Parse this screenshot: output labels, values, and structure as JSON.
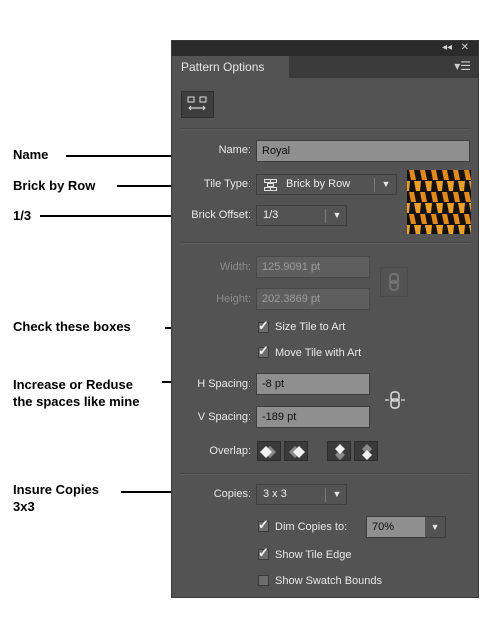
{
  "annotations": {
    "name": "Name",
    "brick_by_row": "Brick by Row",
    "brick_offset": "1/3",
    "check_boxes": "Check these boxes",
    "spacing_line1": "Increase or Reduse",
    "spacing_line2": "the spaces like mine",
    "copies_line1": "Insure Copies",
    "copies_line2": "3x3"
  },
  "panel": {
    "tab_title": "Pattern Options",
    "name_label": "Name:",
    "name_value": "Royal",
    "tile_type_label": "Tile Type:",
    "tile_type_value": "Brick by Row",
    "brick_offset_label": "Brick Offset:",
    "brick_offset_value": "1/3",
    "width_label": "Width:",
    "width_value": "125.9091 pt",
    "height_label": "Height:",
    "height_value": "202.3869 pt",
    "size_tile_label": "Size Tile to Art",
    "size_tile_checked": true,
    "move_tile_label": "Move Tile with Art",
    "move_tile_checked": true,
    "h_spacing_label": "H Spacing:",
    "h_spacing_value": "-8 pt",
    "v_spacing_label": "V Spacing:",
    "v_spacing_value": "-189 pt",
    "overlap_label": "Overlap:",
    "copies_label": "Copies:",
    "copies_value": "3 x 3",
    "dim_copies_label": "Dim Copies to:",
    "dim_copies_checked": true,
    "dim_copies_value": "70%",
    "show_tile_edge_label": "Show Tile Edge",
    "show_tile_edge_checked": true,
    "show_swatch_bounds_label": "Show Swatch Bounds",
    "show_swatch_bounds_checked": false
  },
  "icons": {
    "collapse": "double-chevron-left-icon",
    "close": "close-icon",
    "panel_menu": "panel-menu-icon",
    "pattern_tile_tool": "pattern-tile-tool-icon",
    "brick_row": "brick-by-row-icon",
    "link": "link-chain-icon",
    "spacing_link": "spacing-link-icon"
  },
  "colors": {
    "panel_bg": "#535353",
    "field_bg": "#8f8f8f",
    "swatch_orange": "#e88a12"
  }
}
